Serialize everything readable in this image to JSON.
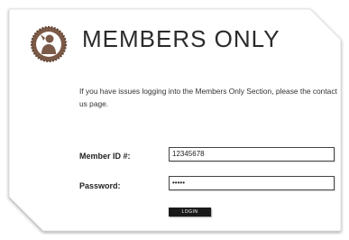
{
  "header": {
    "title": "MEMBERS ONLY",
    "logo_icon": "silhouette-seal-icon"
  },
  "notice": {
    "text": "If you have issues logging into the Members Only Section, please the contact us page."
  },
  "form": {
    "member_id_label": "Member ID #:",
    "member_id_value": "12345678",
    "password_label": "Password:",
    "password_value": "•••••",
    "login_label": "LOGIN"
  },
  "colors": {
    "logo_brown": "#7b5a47",
    "title_text": "#2b2b2b",
    "button_bg": "#1a1a1a"
  }
}
